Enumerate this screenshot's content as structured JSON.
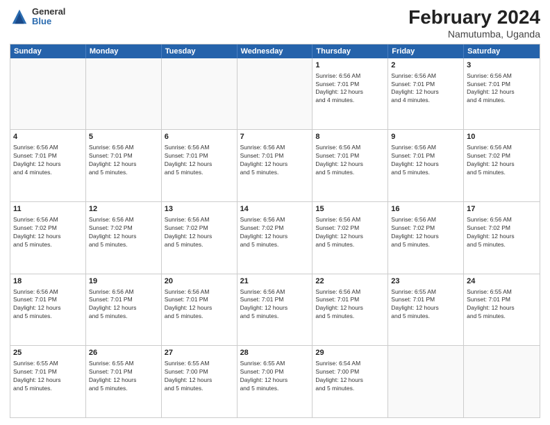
{
  "logo": {
    "general": "General",
    "blue": "Blue"
  },
  "header": {
    "month_year": "February 2024",
    "location": "Namutumba, Uganda"
  },
  "weekdays": [
    "Sunday",
    "Monday",
    "Tuesday",
    "Wednesday",
    "Thursday",
    "Friday",
    "Saturday"
  ],
  "rows": [
    [
      {
        "day": "",
        "empty": true
      },
      {
        "day": "",
        "empty": true
      },
      {
        "day": "",
        "empty": true
      },
      {
        "day": "",
        "empty": true
      },
      {
        "day": "1",
        "info": "Sunrise: 6:56 AM\nSunset: 7:01 PM\nDaylight: 12 hours\nand 4 minutes."
      },
      {
        "day": "2",
        "info": "Sunrise: 6:56 AM\nSunset: 7:01 PM\nDaylight: 12 hours\nand 4 minutes."
      },
      {
        "day": "3",
        "info": "Sunrise: 6:56 AM\nSunset: 7:01 PM\nDaylight: 12 hours\nand 4 minutes."
      }
    ],
    [
      {
        "day": "4",
        "info": "Sunrise: 6:56 AM\nSunset: 7:01 PM\nDaylight: 12 hours\nand 4 minutes."
      },
      {
        "day": "5",
        "info": "Sunrise: 6:56 AM\nSunset: 7:01 PM\nDaylight: 12 hours\nand 5 minutes."
      },
      {
        "day": "6",
        "info": "Sunrise: 6:56 AM\nSunset: 7:01 PM\nDaylight: 12 hours\nand 5 minutes."
      },
      {
        "day": "7",
        "info": "Sunrise: 6:56 AM\nSunset: 7:01 PM\nDaylight: 12 hours\nand 5 minutes."
      },
      {
        "day": "8",
        "info": "Sunrise: 6:56 AM\nSunset: 7:01 PM\nDaylight: 12 hours\nand 5 minutes."
      },
      {
        "day": "9",
        "info": "Sunrise: 6:56 AM\nSunset: 7:01 PM\nDaylight: 12 hours\nand 5 minutes."
      },
      {
        "day": "10",
        "info": "Sunrise: 6:56 AM\nSunset: 7:02 PM\nDaylight: 12 hours\nand 5 minutes."
      }
    ],
    [
      {
        "day": "11",
        "info": "Sunrise: 6:56 AM\nSunset: 7:02 PM\nDaylight: 12 hours\nand 5 minutes."
      },
      {
        "day": "12",
        "info": "Sunrise: 6:56 AM\nSunset: 7:02 PM\nDaylight: 12 hours\nand 5 minutes."
      },
      {
        "day": "13",
        "info": "Sunrise: 6:56 AM\nSunset: 7:02 PM\nDaylight: 12 hours\nand 5 minutes."
      },
      {
        "day": "14",
        "info": "Sunrise: 6:56 AM\nSunset: 7:02 PM\nDaylight: 12 hours\nand 5 minutes."
      },
      {
        "day": "15",
        "info": "Sunrise: 6:56 AM\nSunset: 7:02 PM\nDaylight: 12 hours\nand 5 minutes."
      },
      {
        "day": "16",
        "info": "Sunrise: 6:56 AM\nSunset: 7:02 PM\nDaylight: 12 hours\nand 5 minutes."
      },
      {
        "day": "17",
        "info": "Sunrise: 6:56 AM\nSunset: 7:02 PM\nDaylight: 12 hours\nand 5 minutes."
      }
    ],
    [
      {
        "day": "18",
        "info": "Sunrise: 6:56 AM\nSunset: 7:01 PM\nDaylight: 12 hours\nand 5 minutes."
      },
      {
        "day": "19",
        "info": "Sunrise: 6:56 AM\nSunset: 7:01 PM\nDaylight: 12 hours\nand 5 minutes."
      },
      {
        "day": "20",
        "info": "Sunrise: 6:56 AM\nSunset: 7:01 PM\nDaylight: 12 hours\nand 5 minutes."
      },
      {
        "day": "21",
        "info": "Sunrise: 6:56 AM\nSunset: 7:01 PM\nDaylight: 12 hours\nand 5 minutes."
      },
      {
        "day": "22",
        "info": "Sunrise: 6:56 AM\nSunset: 7:01 PM\nDaylight: 12 hours\nand 5 minutes."
      },
      {
        "day": "23",
        "info": "Sunrise: 6:55 AM\nSunset: 7:01 PM\nDaylight: 12 hours\nand 5 minutes."
      },
      {
        "day": "24",
        "info": "Sunrise: 6:55 AM\nSunset: 7:01 PM\nDaylight: 12 hours\nand 5 minutes."
      }
    ],
    [
      {
        "day": "25",
        "info": "Sunrise: 6:55 AM\nSunset: 7:01 PM\nDaylight: 12 hours\nand 5 minutes."
      },
      {
        "day": "26",
        "info": "Sunrise: 6:55 AM\nSunset: 7:01 PM\nDaylight: 12 hours\nand 5 minutes."
      },
      {
        "day": "27",
        "info": "Sunrise: 6:55 AM\nSunset: 7:00 PM\nDaylight: 12 hours\nand 5 minutes."
      },
      {
        "day": "28",
        "info": "Sunrise: 6:55 AM\nSunset: 7:00 PM\nDaylight: 12 hours\nand 5 minutes."
      },
      {
        "day": "29",
        "info": "Sunrise: 6:54 AM\nSunset: 7:00 PM\nDaylight: 12 hours\nand 5 minutes."
      },
      {
        "day": "",
        "empty": true
      },
      {
        "day": "",
        "empty": true
      }
    ]
  ]
}
